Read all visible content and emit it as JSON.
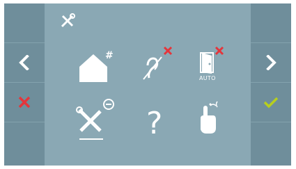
{
  "header": {
    "icon": "tools-icon"
  },
  "colors": {
    "screen_bg": "#8aa8b4",
    "side_bg": "#6f8e9b",
    "icon_white": "#ffffff",
    "cancel_red": "#e5353b",
    "confirm_green": "#b7cf1d"
  },
  "nav": {
    "prev_icon": "chevron-left-icon",
    "next_icon": "chevron-right-icon",
    "cancel_icon": "cancel-x-icon",
    "confirm_icon": "checkmark-icon"
  },
  "menu": {
    "items": [
      {
        "icon": "home-hash-icon",
        "badge": "#"
      },
      {
        "icon": "hearing-loop-icon",
        "status": "off"
      },
      {
        "icon": "door-auto-icon",
        "label": "AUTO",
        "status": "off"
      },
      {
        "icon": "tools-settings-icon"
      },
      {
        "icon": "help-icon",
        "symbol": "?"
      },
      {
        "icon": "touch-sound-icon"
      }
    ]
  }
}
